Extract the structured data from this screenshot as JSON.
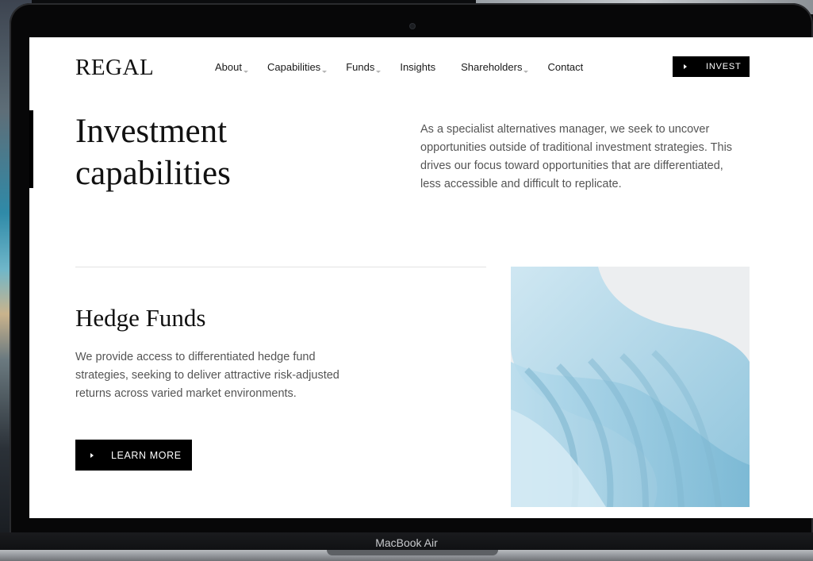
{
  "device": {
    "label": "MacBook Air"
  },
  "site": {
    "logo": "REGAL",
    "nav": [
      {
        "label": "About",
        "dropdown": true
      },
      {
        "label": "Capabilities",
        "dropdown": true
      },
      {
        "label": "Funds",
        "dropdown": true
      },
      {
        "label": "Insights",
        "dropdown": false
      },
      {
        "label": "Shareholders",
        "dropdown": true
      },
      {
        "label": "Contact",
        "dropdown": false
      }
    ],
    "invest_button": "INVEST"
  },
  "hero": {
    "title_line1": "Investment",
    "title_line2": "capabilities",
    "intro": "As a specialist alternatives manager, we seek to uncover opportunities outside of traditional investment strategies. This drives our focus toward opportunities that are differentiated, less accessible and difficult to replicate."
  },
  "section": {
    "title": "Hedge Funds",
    "description": "We provide access to differentiated hedge fund strategies, seeking to deliver attractive risk-adjusted returns across varied market environments.",
    "button": "LEARN MORE"
  },
  "colors": {
    "accent": "#000000",
    "text": "#111111",
    "muted_text": "#555555",
    "art_blue": "#a9d3e6"
  }
}
